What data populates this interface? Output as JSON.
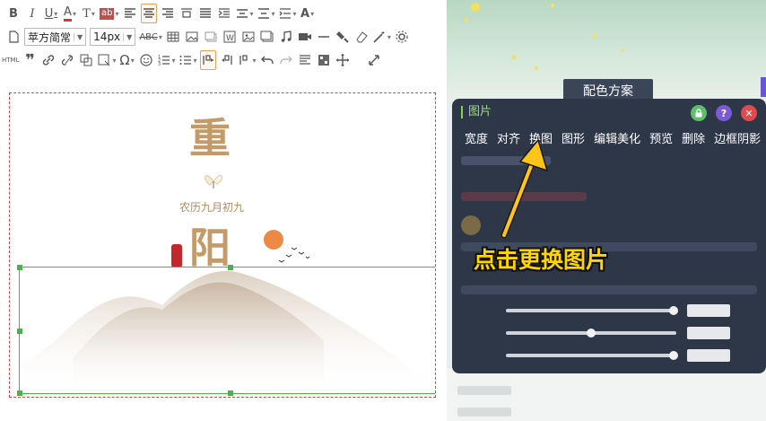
{
  "toolbar": {
    "font_family": "苹方简常",
    "font_size": "14px",
    "html_label": "HTML",
    "spell_label": "ABC",
    "omega_label": "Ω"
  },
  "canvas": {
    "title_char_1": "重",
    "lunar_date": "农历九月初九",
    "title_char_2": "阳"
  },
  "right_panel": {
    "color_scheme_tab": "配色方案"
  },
  "popup": {
    "title": "图片",
    "menu": [
      "宽度",
      "对齐",
      "换图",
      "图形",
      "编辑美化",
      "预览",
      "删除",
      "边框阴影"
    ],
    "icon_colors": {
      "lock": "#5cbf6b",
      "help": "#7a5ad6",
      "close": "#e04a4a"
    }
  },
  "annotation": {
    "callout": "点击更换图片",
    "color": "#ffd500"
  }
}
